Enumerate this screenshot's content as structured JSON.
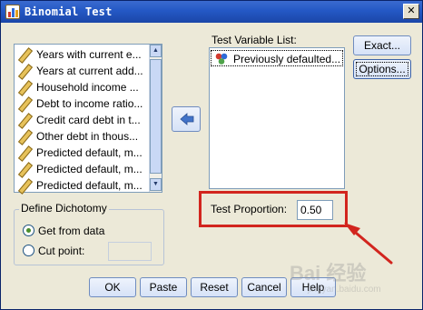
{
  "window": {
    "title": "Binomial Test"
  },
  "variables": [
    "Years with current e...",
    "Years at current add...",
    "Household income ...",
    "Debt to income ratio...",
    "Credit card debt in t...",
    "Other debt in thous...",
    "Predicted default, m...",
    "Predicted default, m...",
    "Predicted default, m..."
  ],
  "test_variable_list": {
    "label": "Test Variable List:",
    "items": [
      "Previously defaulted..."
    ]
  },
  "side_buttons": {
    "exact": "Exact...",
    "options": "Options..."
  },
  "test_proportion": {
    "label": "Test Proportion:",
    "value": "0.50"
  },
  "dichotomy": {
    "title": "Define Dichotomy",
    "get_from_data": "Get from data",
    "cut_point": "Cut point:",
    "selected": "get_from_data"
  },
  "bottom_buttons": {
    "ok": "OK",
    "paste": "Paste",
    "reset": "Reset",
    "cancel": "Cancel",
    "help": "Help"
  },
  "watermark": {
    "text": "Bai 经验",
    "url": "jingyan.baidu.com"
  },
  "colors": {
    "title_bar": "#2458c5",
    "dialog_bg": "#ece9d8",
    "highlight": "#d2251e"
  }
}
